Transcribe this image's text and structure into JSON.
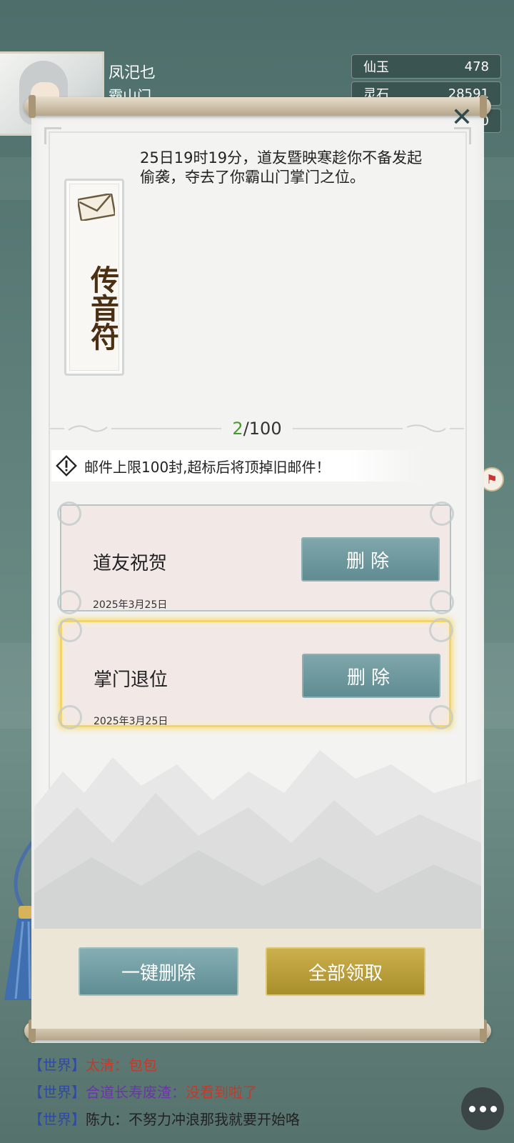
{
  "player": {
    "name": "凤汜乜",
    "sect": "霸山门"
  },
  "resources": [
    {
      "name": "仙玉",
      "value": "478"
    },
    {
      "name": "灵石",
      "value": "28591"
    },
    {
      "name": "",
      "value": "10"
    }
  ],
  "mail": {
    "sender_badge": [
      "传",
      "音",
      "符"
    ],
    "content": "25日19时19分，道友暨映寒趁你不备发起偷袭，夺去了你霸山门掌门之位。",
    "count_current": "2",
    "count_total": "/100",
    "notice": "邮件上限100封,超标后将顶掉旧邮件！",
    "items": [
      {
        "title": "道友祝贺",
        "date": "2025年3月25日",
        "delete_label": "删除",
        "selected": false
      },
      {
        "title": "掌门退位",
        "date": "2025年3月25日",
        "delete_label": "删除",
        "selected": true
      }
    ],
    "delete_all_label": "一键删除",
    "claim_all_label": "全部领取",
    "close_icon": "close-icon"
  },
  "chat": [
    {
      "channel": "【世界】",
      "name": "太清",
      "sep": "：",
      "message": "包包"
    },
    {
      "channel": "【世界】",
      "name": "合道长寿废渣",
      "sep": "：",
      "message": "没看到啦了"
    },
    {
      "channel": "【世界】",
      "name": "陈九",
      "sep": "：",
      "message": "不努力冲浪那我就要开始咯"
    }
  ],
  "colors": {
    "accent_teal": "#6f9aa0",
    "accent_gold": "#b89a36",
    "counter_green": "#4a9a2e",
    "chat_channel": "#2e49a7",
    "chat_red": "#c23a2b"
  }
}
